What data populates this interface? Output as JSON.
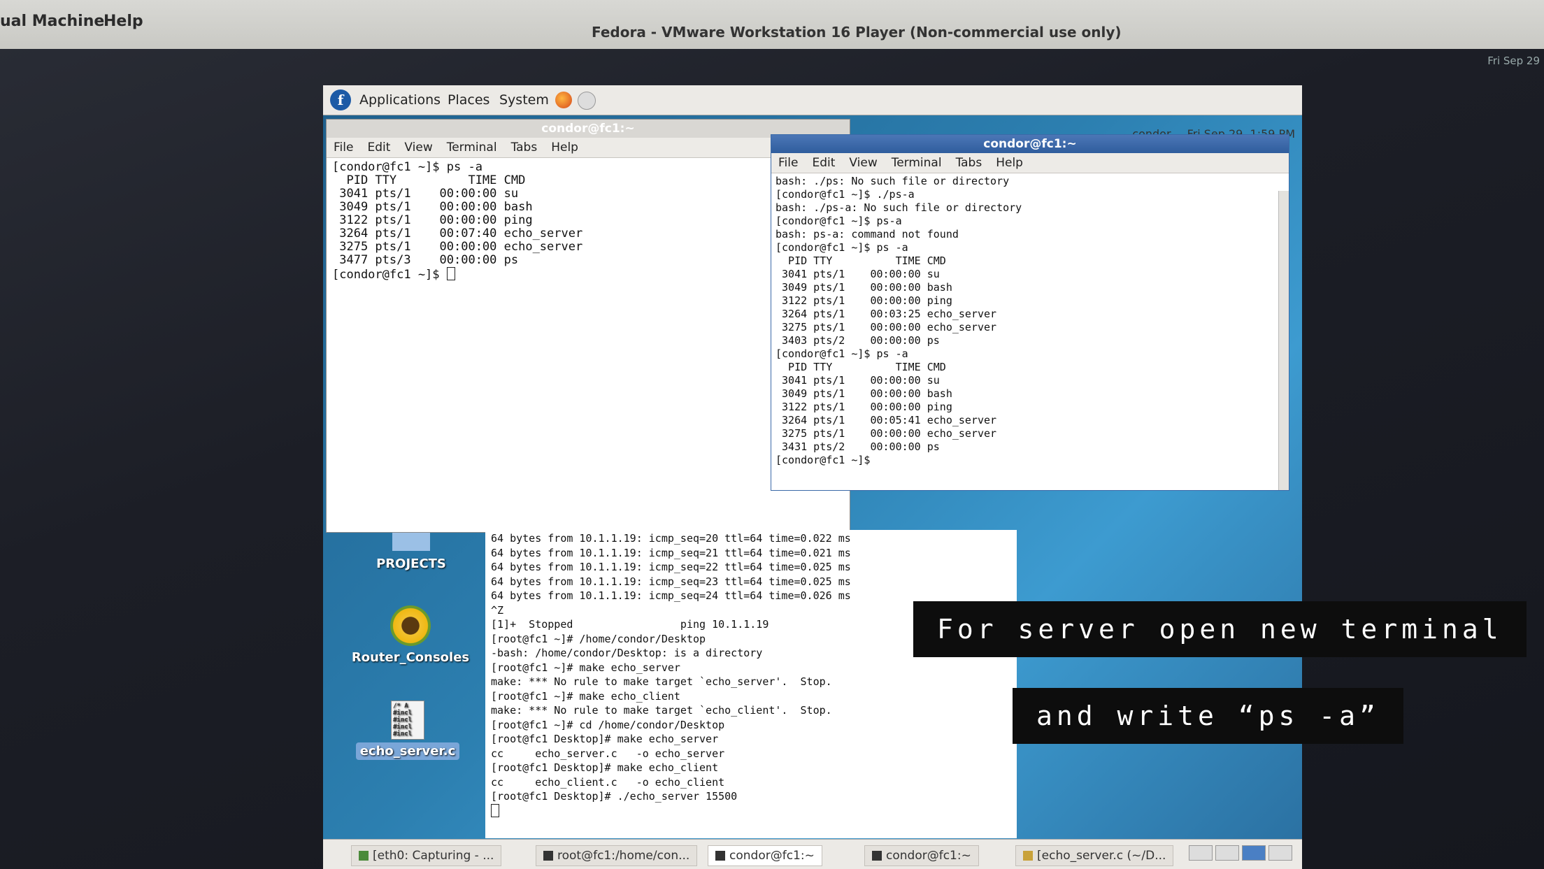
{
  "host": {
    "menu_left": "ual Machine",
    "menu_help": "Help",
    "title": "Fedora - VMware Workstation 16 Player (Non-commercial use only)",
    "clock": "Fri Sep 29"
  },
  "panel": {
    "logo": "f",
    "applications": "Applications",
    "places": "Places",
    "system": "System",
    "user": "condor",
    "clock": "Fri Sep 29,  1:59 PM"
  },
  "terminal_left": {
    "title": "condor@fc1:~",
    "menu": [
      "File",
      "Edit",
      "View",
      "Terminal",
      "Tabs",
      "Help"
    ],
    "lines": [
      "[condor@fc1 ~]$ ps -a",
      "  PID TTY          TIME CMD",
      " 3041 pts/1    00:00:00 su",
      " 3049 pts/1    00:00:00 bash",
      " 3122 pts/1    00:00:00 ping",
      " 3264 pts/1    00:07:40 echo_server",
      " 3275 pts/1    00:00:00 echo_server",
      " 3477 pts/3    00:00:00 ps"
    ],
    "prompt": "[condor@fc1 ~]$ "
  },
  "terminal_right": {
    "title": "condor@fc1:~",
    "menu": [
      "File",
      "Edit",
      "View",
      "Terminal",
      "Tabs",
      "Help"
    ],
    "lines": [
      "bash: ./ps: No such file or directory",
      "[condor@fc1 ~]$ ./ps-a",
      "bash: ./ps-a: No such file or directory",
      "[condor@fc1 ~]$ ps-a",
      "bash: ps-a: command not found",
      "[condor@fc1 ~]$ ps -a",
      "  PID TTY          TIME CMD",
      " 3041 pts/1    00:00:00 su",
      " 3049 pts/1    00:00:00 bash",
      " 3122 pts/1    00:00:00 ping",
      " 3264 pts/1    00:03:25 echo_server",
      " 3275 pts/1    00:00:00 echo_server",
      " 3403 pts/2    00:00:00 ps",
      "[condor@fc1 ~]$ ps -a",
      "  PID TTY          TIME CMD",
      " 3041 pts/1    00:00:00 su",
      " 3049 pts/1    00:00:00 bash",
      " 3122 pts/1    00:00:00 ping",
      " 3264 pts/1    00:05:41 echo_server",
      " 3275 pts/1    00:00:00 echo_server",
      " 3431 pts/2    00:00:00 ps",
      "[condor@fc1 ~]$"
    ]
  },
  "terminal_root": {
    "lines": [
      "64 bytes from 10.1.1.19: icmp_seq=20 ttl=64 time=0.022 ms",
      "64 bytes from 10.1.1.19: icmp_seq=21 ttl=64 time=0.021 ms",
      "64 bytes from 10.1.1.19: icmp_seq=22 ttl=64 time=0.025 ms",
      "64 bytes from 10.1.1.19: icmp_seq=23 ttl=64 time=0.025 ms",
      "64 bytes from 10.1.1.19: icmp_seq=24 ttl=64 time=0.026 ms",
      "^Z",
      "[1]+  Stopped                 ping 10.1.1.19",
      "[root@fc1 ~]# /home/condor/Desktop",
      "-bash: /home/condor/Desktop: is a directory",
      "[root@fc1 ~]# make echo_server",
      "make: *** No rule to make target `echo_server'.  Stop.",
      "[root@fc1 ~]# make echo_client",
      "make: *** No rule to make target `echo_client'.  Stop.",
      "[root@fc1 ~]# cd /home/condor/Desktop",
      "[root@fc1 Desktop]# make echo_server",
      "cc     echo_server.c   -o echo_server",
      "[root@fc1 Desktop]# make echo_client",
      "cc     echo_client.c   -o echo_client",
      "[root@fc1 Desktop]# ./echo_server 15500"
    ]
  },
  "desktop": {
    "projects": "PROJECTS",
    "router_consoles": "Router_Consoles",
    "echo_server_file": "echo_server.c",
    "file_preview": "/* A\n#incl\n#incl\n#incl\n#incl"
  },
  "taskbar": {
    "items": [
      "[eth0: Capturing - ...",
      "root@fc1:/home/con...",
      "condor@fc1:~",
      "condor@fc1:~",
      "[echo_server.c (~/D..."
    ]
  },
  "captions": {
    "line1": "For server open new terminal",
    "line2": "and write “ps -a”"
  }
}
